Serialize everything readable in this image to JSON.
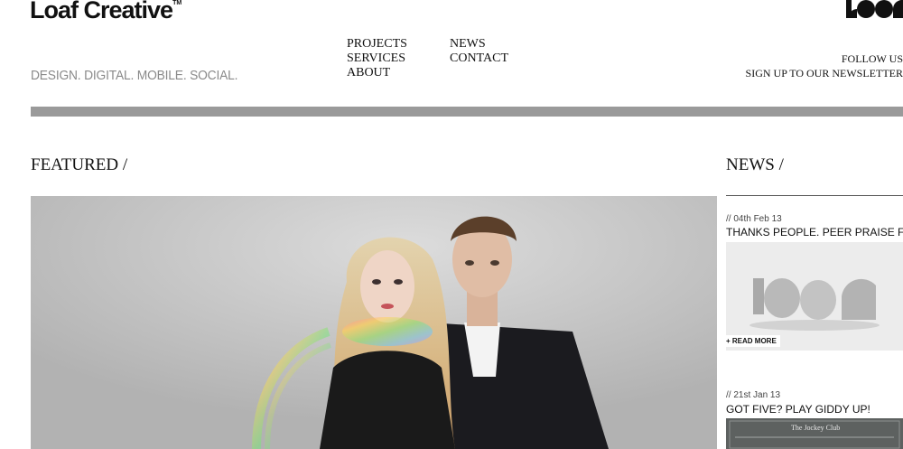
{
  "header": {
    "logo_text": "Loaf Creative",
    "logo_tm": "TM",
    "tagline": "DESIGN. DIGITAL. MOBILE. SOCIAL.",
    "mark_icon": "loaf-mark-icon"
  },
  "nav": {
    "col1": [
      "PROJECTS",
      "SERVICES",
      "ABOUT"
    ],
    "col2": [
      "NEWS",
      "CONTACT"
    ]
  },
  "right_links": {
    "follow": "FOLLOW US",
    "newsletter": "SIGN UP TO OUR NEWSLETTER"
  },
  "featured": {
    "title": "FEATURED /"
  },
  "news": {
    "title": "NEWS /",
    "items": [
      {
        "date": "// 04th Feb 13",
        "headline": "THANKS PEOPLE. PEER PRAISE FOR LOAF",
        "read_more": "+ READ MORE"
      },
      {
        "date": "// 21st Jan 13",
        "headline": "GOT FIVE? PLAY GIDDY UP!",
        "thumb_text": "The Jockey Club"
      }
    ]
  },
  "colors": {
    "bar": "#9a9a9a",
    "tagline": "#8a8a8a",
    "text": "#111111"
  }
}
